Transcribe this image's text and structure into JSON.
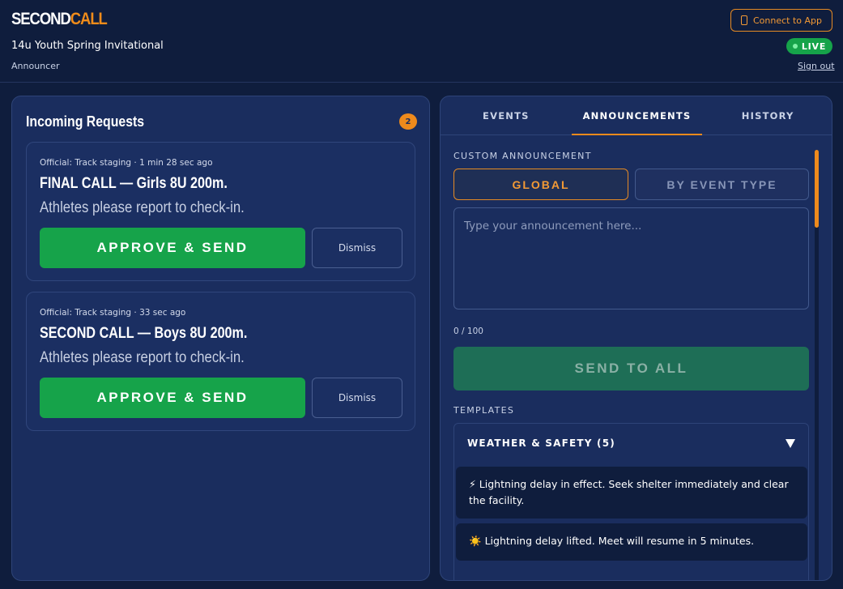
{
  "header": {
    "logo_first": "SECOND",
    "logo_second": "CALL",
    "event_title": "14u Youth Spring Invitational",
    "role": "Announcer",
    "connect_label": "Connect to App",
    "live_label": "LIVE",
    "signout_label": "Sign out"
  },
  "requests": {
    "title": "Incoming Requests",
    "count": "2",
    "items": [
      {
        "meta": "Official: Track staging · 1 min 28 sec ago",
        "title": "FINAL CALL — Girls 8U 200m.",
        "subtitle": "Athletes please report to check-in.",
        "approve_label": "APPROVE & SEND",
        "dismiss_label": "Dismiss"
      },
      {
        "meta": "Official: Track staging · 33 sec ago",
        "title": "SECOND CALL — Boys 8U 200m.",
        "subtitle": "Athletes please report to check-in.",
        "approve_label": "APPROVE & SEND",
        "dismiss_label": "Dismiss"
      }
    ]
  },
  "tabs": [
    {
      "label": "EVENTS",
      "active": false
    },
    {
      "label": "ANNOUNCEMENTS",
      "active": true
    },
    {
      "label": "HISTORY",
      "active": false
    }
  ],
  "announcement": {
    "section_label": "CUSTOM ANNOUNCEMENT",
    "scope_global": "GLOBAL",
    "scope_event_type": "BY EVENT TYPE",
    "placeholder": "Type your announcement here...",
    "char_count": "0 / 100",
    "send_label": "SEND TO ALL"
  },
  "templates": {
    "section_label": "TEMPLATES",
    "group_title": "WEATHER & SAFETY (5)",
    "items": [
      {
        "icon": "⚡",
        "text": "Lightning delay in effect. Seek shelter immediately and clear the facility."
      },
      {
        "icon": "☀️",
        "text": "Lightning delay lifted. Meet will resume in 5 minutes."
      }
    ]
  },
  "colors": {
    "background": "#0f1d3d",
    "panel": "#1a2d5e",
    "accent_orange": "#ee8a1c",
    "approve_green": "#16a34a"
  }
}
